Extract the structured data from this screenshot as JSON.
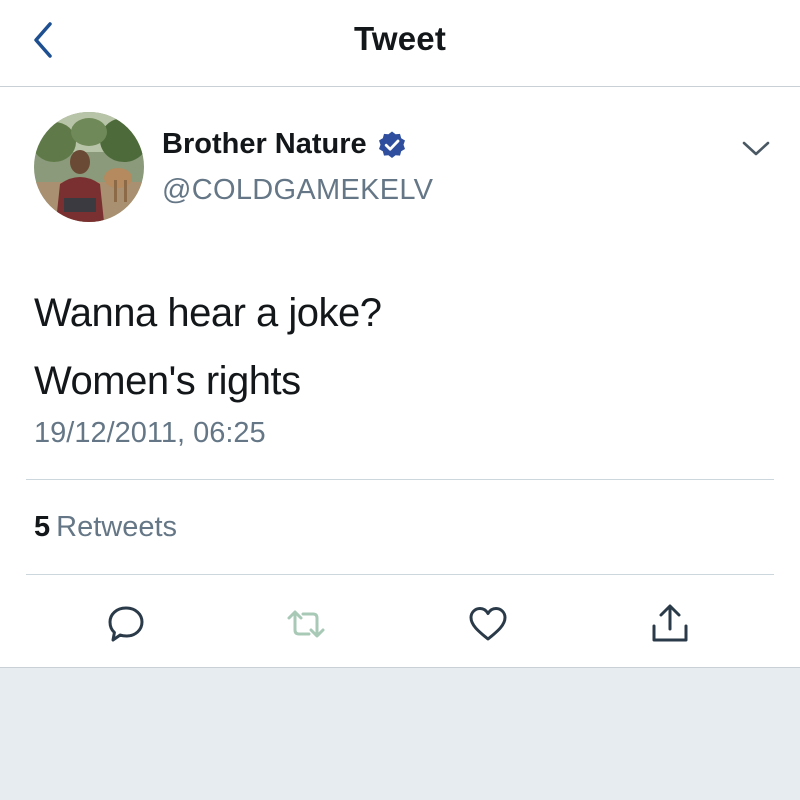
{
  "header": {
    "title": "Tweet",
    "back_icon": "chevron-left-icon"
  },
  "tweet": {
    "author_name": "Brother Nature",
    "verified": true,
    "handle": "@COLDGAMEKELV",
    "text_lines": [
      "Wanna hear a joke?",
      "Women's rights"
    ],
    "timestamp": "19/12/2011, 06:25",
    "retweet_count": "5",
    "retweet_label": "Retweets",
    "more_icon": "chevron-down-icon"
  },
  "actions": {
    "reply_icon": "comment-bubble-icon",
    "retweet_icon": "retweet-icon",
    "like_icon": "heart-icon",
    "share_icon": "share-icon"
  },
  "colors": {
    "accent": "#1da1f2",
    "text_primary": "#14171a",
    "text_secondary": "#657786",
    "retweet_muted": "#a8c9b5",
    "background": "#e6ecf0"
  }
}
